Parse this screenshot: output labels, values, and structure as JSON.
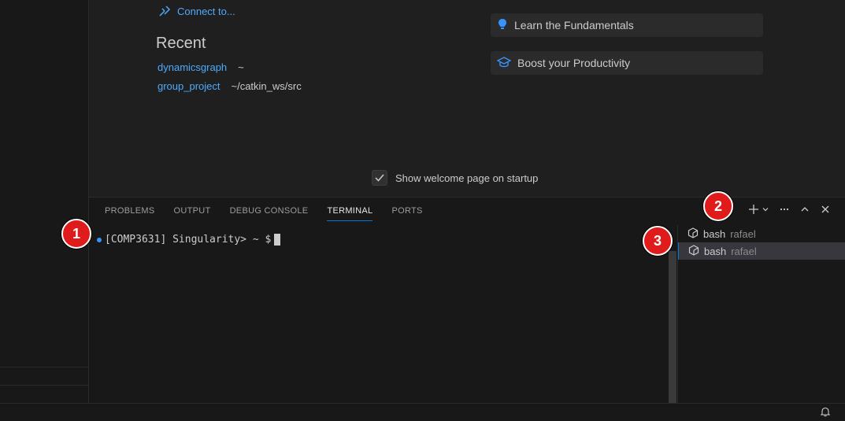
{
  "welcome": {
    "connect_label": "Connect to...",
    "recent_title": "Recent",
    "recent": [
      {
        "name": "dynamicsgraph",
        "path": "~"
      },
      {
        "name": "group_project",
        "path": "~/catkin_ws/src"
      }
    ],
    "walkthroughs": [
      {
        "label": "Learn the Fundamentals",
        "icon": "lightbulb-icon"
      },
      {
        "label": "Boost your Productivity",
        "icon": "mortarboard-icon"
      }
    ],
    "show_on_startup_label": "Show welcome page on startup",
    "show_on_startup_checked": true
  },
  "panel": {
    "tabs": [
      "PROBLEMS",
      "OUTPUT",
      "DEBUG CONSOLE",
      "TERMINAL",
      "PORTS"
    ],
    "active_tab": "TERMINAL",
    "prompt": "[COMP3631] Singularity> ~ $",
    "terminals": [
      {
        "name": "bash",
        "sub": "rafael",
        "active": false
      },
      {
        "name": "bash",
        "sub": "rafael",
        "active": true
      }
    ],
    "actions": [
      "plus-icon",
      "chevron-down-icon",
      "more-icon",
      "maximize-icon",
      "close-icon"
    ]
  },
  "annotations": [
    "1",
    "2",
    "3"
  ],
  "colors": {
    "accent": "#0078d4",
    "link": "#4daafc",
    "badge": "#e01b1b"
  }
}
